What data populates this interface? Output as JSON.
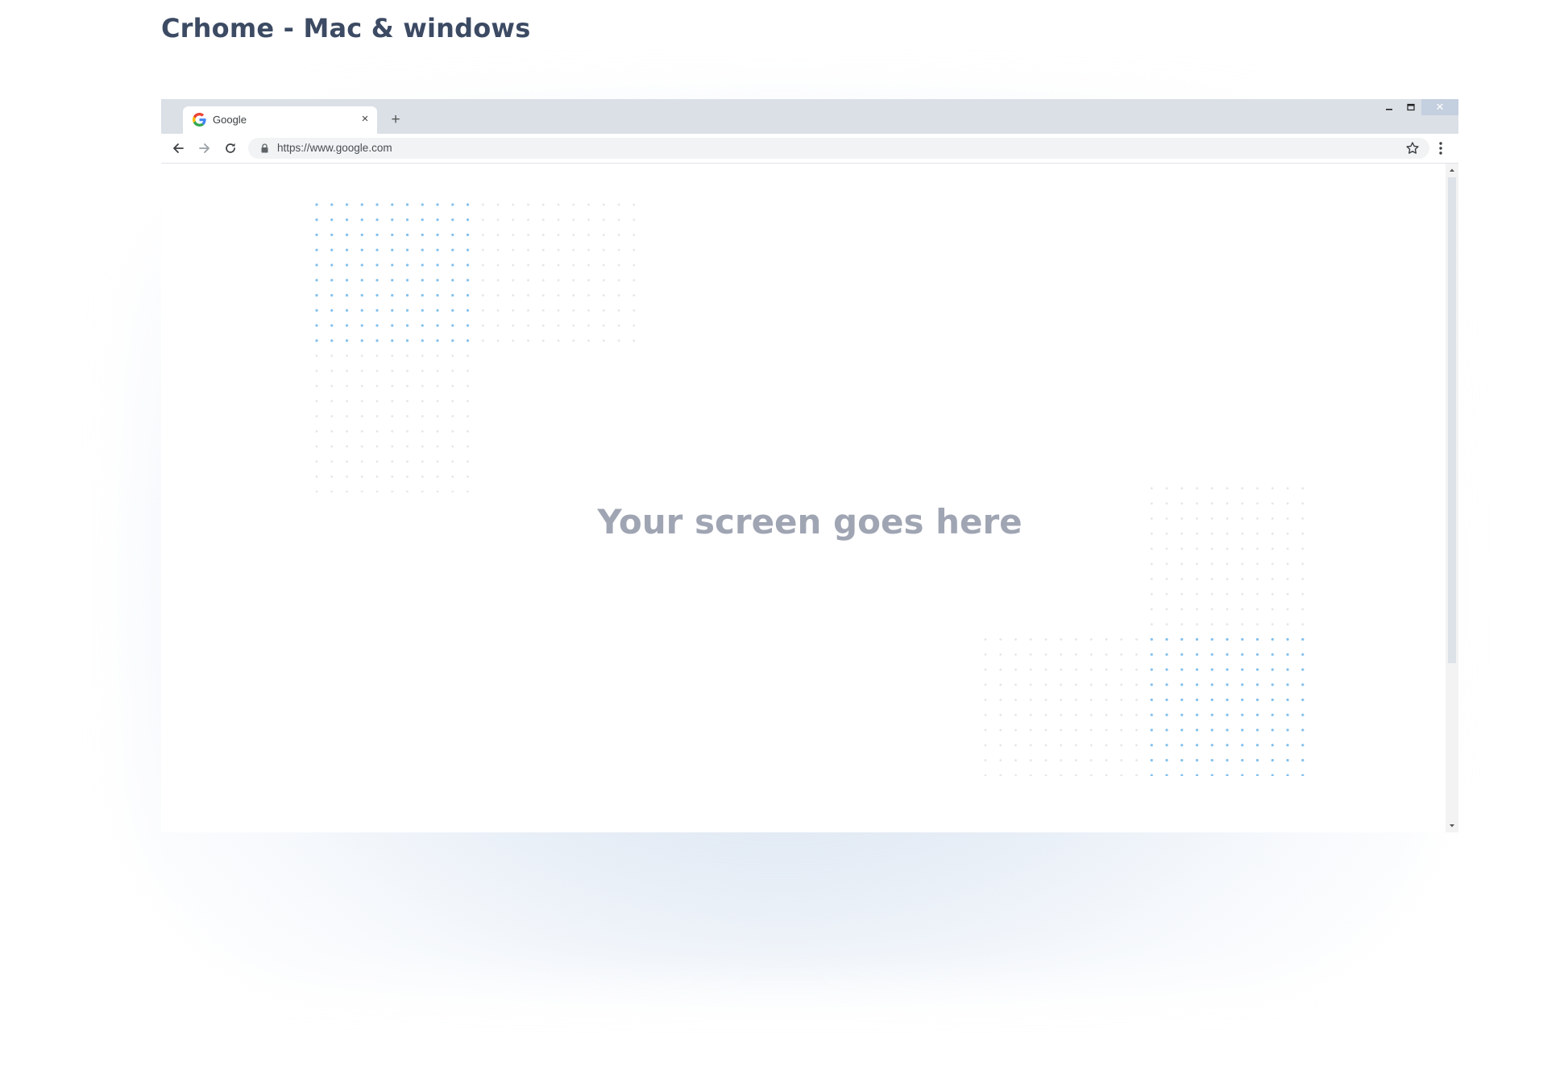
{
  "page": {
    "title": "Crhome - Mac & windows"
  },
  "browser": {
    "tab": {
      "title": "Google",
      "favicon": "google-g-icon",
      "close_glyph": "×"
    },
    "new_tab_glyph": "+",
    "window_controls": {
      "minimize_icon": "minimize-icon",
      "maximize_icon": "maximize-icon",
      "close_glyph": "✕"
    },
    "toolbar": {
      "back_icon": "arrow-left-icon",
      "forward_icon": "arrow-right-icon",
      "reload_icon": "reload-icon",
      "lock_icon": "lock-icon",
      "url": "https://www.google.com",
      "bookmark_icon": "star-icon",
      "menu_icon": "kebab-menu-icon"
    },
    "content": {
      "placeholder": "Your screen goes here"
    }
  },
  "colors": {
    "title": "#3c4a63",
    "tab_strip": "#dbe0e7",
    "placeholder_text": "#a0a5b3",
    "dot_blue": "#7fbfee",
    "dot_grey": "#e3e6ea"
  }
}
